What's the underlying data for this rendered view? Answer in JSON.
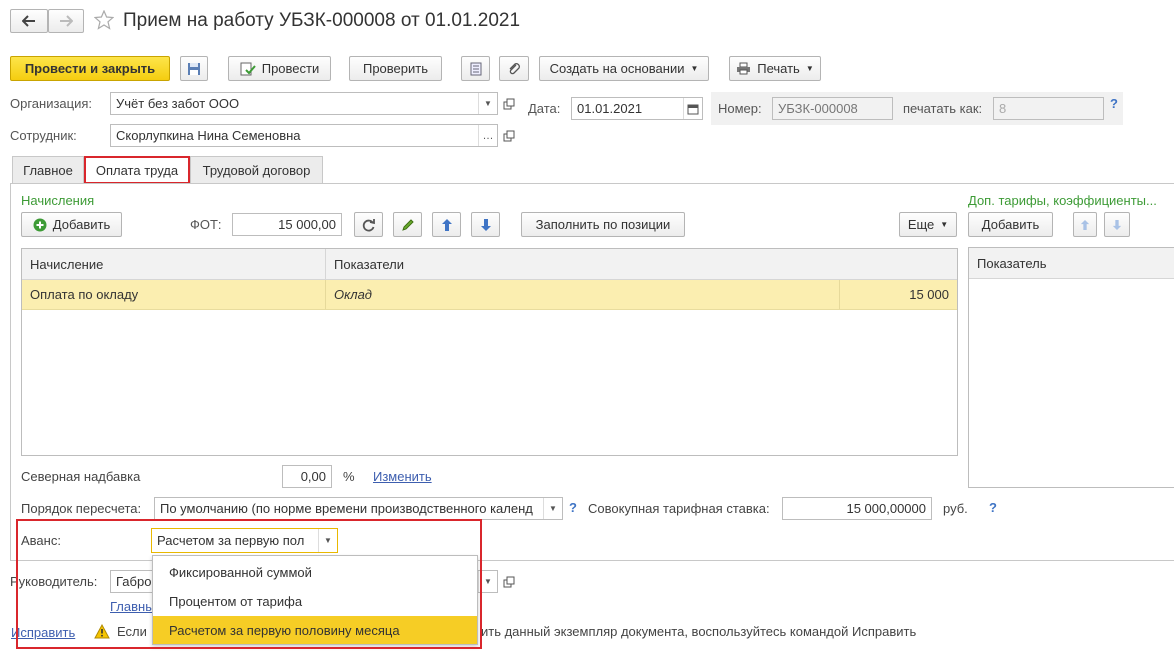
{
  "window": {
    "title": "Прием на работу УБЗК-000008 от 01.01.2021",
    "back_icon": "arrow-left",
    "forward_icon": "arrow-right",
    "favorite_icon": "star"
  },
  "toolbar": {
    "post_close": "Провести и закрыть",
    "post": "Провести",
    "check": "Проверить",
    "create_based": "Создать на основании",
    "print": "Печать"
  },
  "header": {
    "org_label": "Организация:",
    "org_value": "Учёт без забот ООО",
    "date_label": "Дата:",
    "date_value": "01.01.2021",
    "number_label": "Номер:",
    "number_value": "УБЗК-000008",
    "print_as_label": "печатать как:",
    "print_as_placeholder": "8",
    "help": "?",
    "employee_label": "Сотрудник:",
    "employee_value": "Скорлупкина Нина Семеновна"
  },
  "tabs": [
    {
      "label": "Главное",
      "active": false
    },
    {
      "label": "Оплата труда",
      "active": true
    },
    {
      "label": "Трудовой договор",
      "active": false
    }
  ],
  "accruals": {
    "title": "Начисления",
    "add_label": "Добавить",
    "fot_label": "ФОТ:",
    "fot_value": "15 000,00",
    "fill_label": "Заполнить по позиции",
    "more_label": "Еще",
    "columns": [
      "Начисление",
      "Показатели"
    ],
    "rows": [
      {
        "name": "Оплата по окладу",
        "indicator": "Оклад",
        "value": "15 000"
      }
    ]
  },
  "extra_tariffs": {
    "title": "Доп. тарифы, коэффициенты...",
    "add_label": "Добавить",
    "column": "Показатель"
  },
  "north": {
    "label": "Северная надбавка",
    "value": "0,00",
    "unit": "%",
    "change_link": "Изменить"
  },
  "recalc": {
    "label": "Порядок пересчета:",
    "value": "По умолчанию (по норме времени производственного календ",
    "help": "?",
    "total_rate_label": "Совокупная тарифная ставка:",
    "total_rate_value": "15 000,00000",
    "currency": "руб.",
    "help2": "?"
  },
  "advance": {
    "label": "Аванс:",
    "value": "Расчетом за первую пол",
    "options": [
      "Фиксированной суммой",
      "Процентом от тарифа",
      "Расчетом за первую половину месяца"
    ],
    "selected_index": 2
  },
  "manager": {
    "label": "Руководитель:",
    "value_partial": "Габро",
    "link_partial": "Главны"
  },
  "footer": {
    "fix_link": "Исправить",
    "warning_start": "Если",
    "warning_rest": "ить данный экземпляр документа, воспользуйтесь командой Исправить"
  },
  "colors": {
    "accent_yellow": "#f5cd10",
    "selected_row": "#fbeeb0",
    "highlight_red": "#d9262c",
    "green_title": "#3d9b36",
    "link_blue": "#3d5eaf"
  }
}
